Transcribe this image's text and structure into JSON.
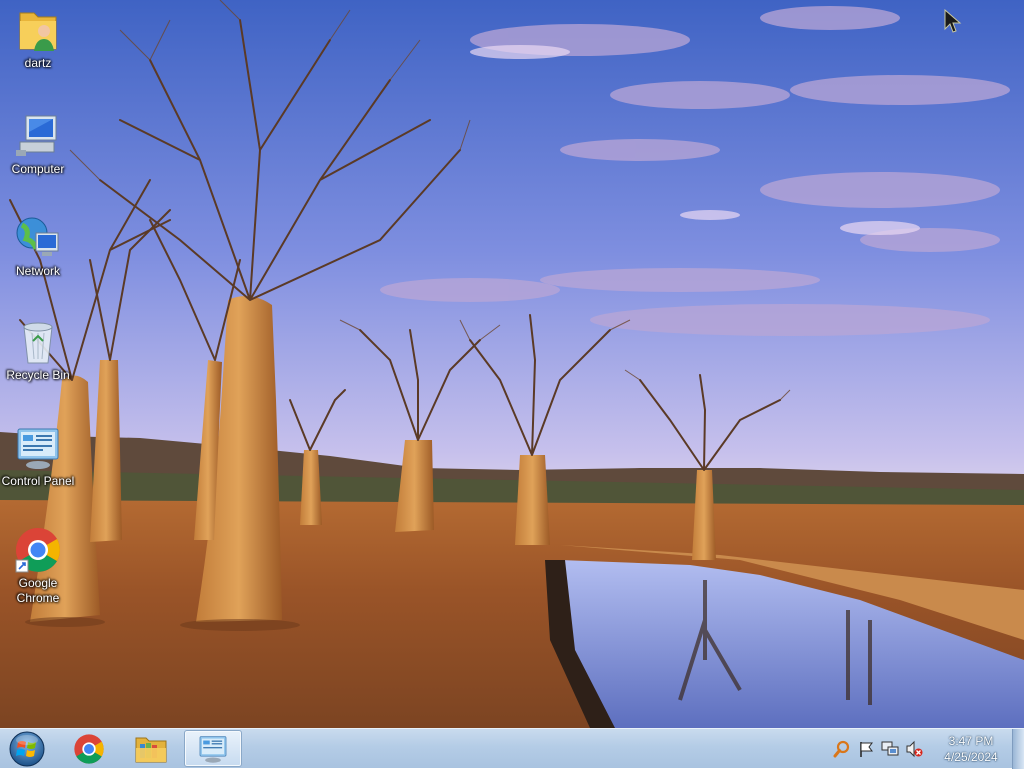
{
  "desktop": {
    "icons": [
      {
        "label": "dartz",
        "icon": "user-folder-icon"
      },
      {
        "label": "Computer",
        "icon": "computer-icon"
      },
      {
        "label": "Network",
        "icon": "network-icon"
      },
      {
        "label": "Recycle Bin",
        "icon": "recycle-bin-icon"
      },
      {
        "label": "Control Panel",
        "icon": "control-panel-icon"
      },
      {
        "label": "Google Chrome",
        "icon": "chrome-icon"
      }
    ],
    "wallpaper": "baobab-trees-at-dusk"
  },
  "taskbar": {
    "start": {
      "icon": "windows-start-icon"
    },
    "pinned": [
      {
        "name": "Google Chrome",
        "icon": "chrome-icon"
      },
      {
        "name": "Windows Explorer",
        "icon": "folder-library-icon"
      },
      {
        "name": "Control Panel",
        "icon": "control-panel-icon",
        "active": true
      }
    ],
    "tray": {
      "icons": [
        "magnifier-icon",
        "action-center-flag-icon",
        "network-status-icon",
        "volume-muted-icon"
      ],
      "time": "3:47 PM",
      "date": "4/25/2024"
    }
  },
  "colors": {
    "taskbar_top": "#c9dbee",
    "taskbar_bottom": "#a9c3e0",
    "sky_top": "#4a6fc9",
    "sky_bottom": "#e4dcef",
    "ground": "#9a5a2c",
    "water": "#7a90d8"
  }
}
